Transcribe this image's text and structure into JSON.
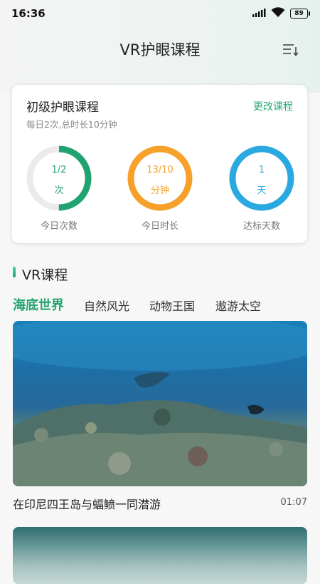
{
  "status_bar": {
    "time": "16:36",
    "battery": "89"
  },
  "header": {
    "title": "VR护眼课程",
    "sort_icon": "sort-list-icon"
  },
  "course_card": {
    "title": "初级护眼课程",
    "subtitle": "每日2次,总时长10分钟",
    "change_label": "更改课程",
    "stats": [
      {
        "value": "1/2",
        "unit": "次",
        "label": "今日次数",
        "progress": 0.5,
        "color": "#21a371"
      },
      {
        "value": "13/10",
        "unit": "分钟",
        "label": "今日时长",
        "progress": 1.0,
        "color": "#f7a12b"
      },
      {
        "value": "1",
        "unit": "天",
        "label": "达标天数",
        "progress": 1.0,
        "color": "#2aa9e0"
      }
    ]
  },
  "vr_section": {
    "title": "VR课程",
    "tabs": [
      "海底世界",
      "自然风光",
      "动物王国",
      "遨游太空"
    ],
    "active_tab": 0,
    "videos": [
      {
        "title": "在印尼四王岛与蝠鲼一同潜游",
        "duration": "01:07"
      }
    ]
  }
}
